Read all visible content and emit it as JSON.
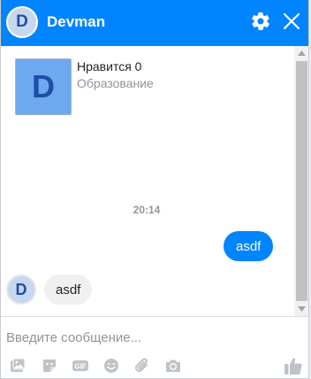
{
  "header": {
    "avatar_letter": "D",
    "title": "Devman",
    "settings_icon": "gear-icon",
    "close_icon": "close-icon"
  },
  "card": {
    "avatar_letter": "D",
    "likes_text": "Нравится 0",
    "category": "Образование"
  },
  "conversation": {
    "timestamp": "20:14",
    "messages": [
      {
        "direction": "outgoing",
        "text": "asdf"
      },
      {
        "direction": "incoming",
        "avatar_letter": "D",
        "text": "asdf"
      }
    ]
  },
  "composer": {
    "placeholder": "Введите сообщение...",
    "toolbar_icons": [
      "image-icon",
      "sticker-icon",
      "gif-icon",
      "emoji-icon",
      "attachment-icon",
      "camera-icon",
      "like-icon"
    ]
  },
  "colors": {
    "accent": "#0084ff",
    "avatar_fill": "#6ea8ee",
    "incoming_bubble": "#f1f0f0",
    "icon_gray": "#bec3c9"
  }
}
